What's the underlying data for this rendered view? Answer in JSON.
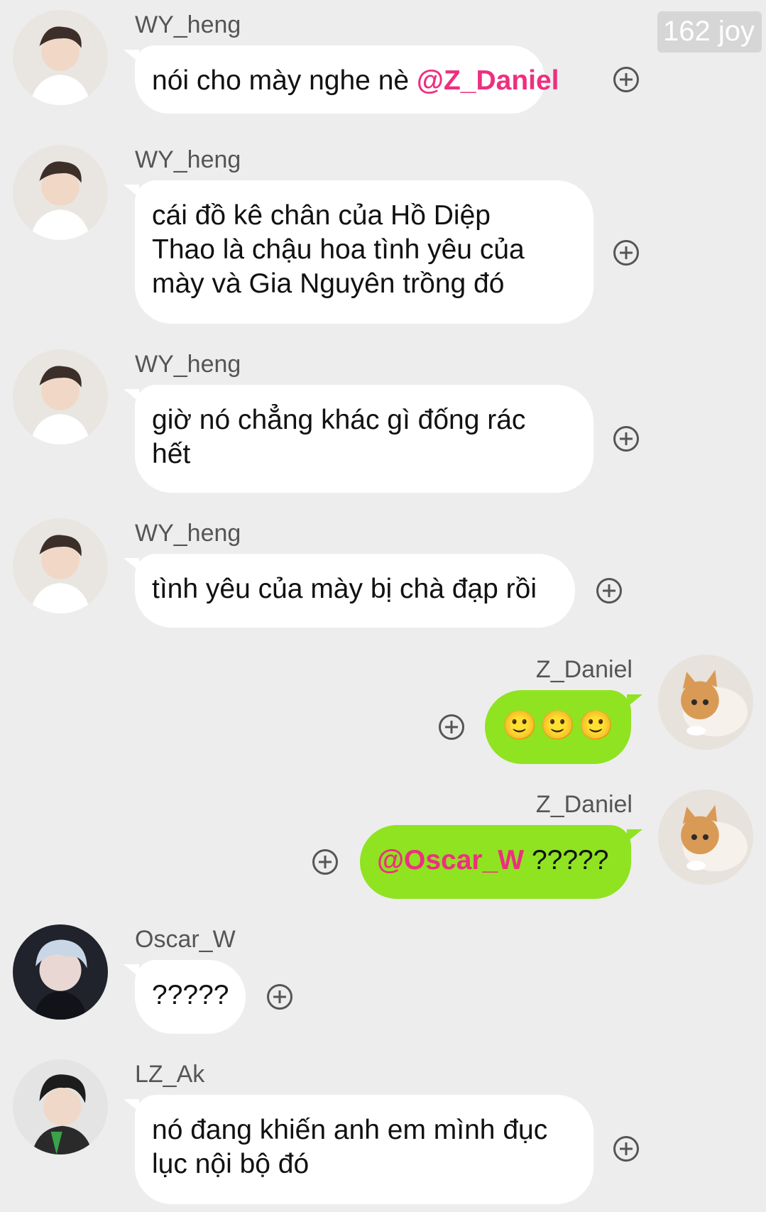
{
  "header": {
    "counter_label": "162 joy"
  },
  "messages": [
    {
      "sender": "WY_heng",
      "text": "nói cho mày nghe nè ",
      "mention": "@Z_Daniel"
    },
    {
      "sender": "WY_heng",
      "text_lines": [
        "cái đồ kê chân của Hồ Diệp",
        "Thao là chậu hoa tình yêu của",
        "mày và Gia Nguyên trồng đó"
      ]
    },
    {
      "sender": "WY_heng",
      "text_lines": [
        "giờ nó chẳng khác gì đống rác",
        "hết"
      ]
    },
    {
      "sender": "WY_heng",
      "text": "tình yêu của mày bị chà đạp rồi"
    },
    {
      "sender": "Z_Daniel",
      "text": "🙂🙂🙂"
    },
    {
      "sender": "Z_Daniel",
      "mention": "@Oscar_W",
      "text": " ?????"
    },
    {
      "sender": "Oscar_W",
      "text": "?????"
    },
    {
      "sender": "LZ_Ak",
      "text_lines": [
        "nó đang khiến anh em mình đục",
        "lục nội bộ đó"
      ]
    }
  ],
  "colors": {
    "background": "#ededed",
    "incoming_bubble": "#ffffff",
    "outgoing_bubble": "#8fe321",
    "mention": "#ee2f7f",
    "sender_name": "#555555"
  },
  "icons": {
    "add": "plus-circle-icon",
    "avatar": "avatar"
  }
}
